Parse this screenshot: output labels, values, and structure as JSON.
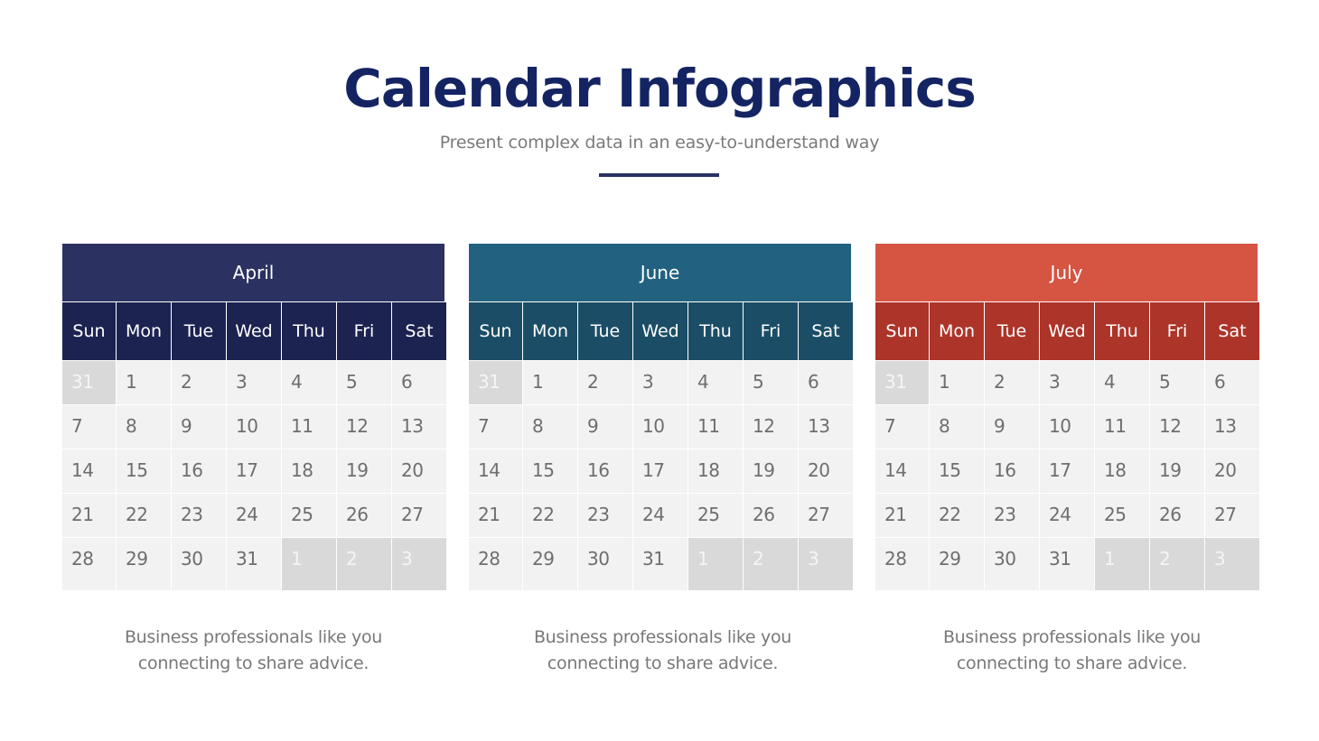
{
  "title": "Calendar Infographics",
  "subtitle": "Present complex data in an easy-to-understand way",
  "weekdays": [
    "Sun",
    "Mon",
    "Tue",
    "Wed",
    "Thu",
    "Fri",
    "Sat"
  ],
  "calendars": [
    {
      "month": "April",
      "header_color": "#2b3262",
      "weekday_color": "#1c2350",
      "caption_line1": "Business professionals like you",
      "caption_line2": "connecting to share advice.",
      "days": [
        {
          "d": "31",
          "other": true
        },
        {
          "d": "1"
        },
        {
          "d": "2"
        },
        {
          "d": "3"
        },
        {
          "d": "4"
        },
        {
          "d": "5"
        },
        {
          "d": "6"
        },
        {
          "d": "7"
        },
        {
          "d": "8"
        },
        {
          "d": "9"
        },
        {
          "d": "10"
        },
        {
          "d": "11"
        },
        {
          "d": "12"
        },
        {
          "d": "13"
        },
        {
          "d": "14"
        },
        {
          "d": "15"
        },
        {
          "d": "16"
        },
        {
          "d": "17"
        },
        {
          "d": "18"
        },
        {
          "d": "19"
        },
        {
          "d": "20"
        },
        {
          "d": "21"
        },
        {
          "d": "22"
        },
        {
          "d": "23"
        },
        {
          "d": "24"
        },
        {
          "d": "25"
        },
        {
          "d": "26"
        },
        {
          "d": "27"
        },
        {
          "d": "28"
        },
        {
          "d": "29"
        },
        {
          "d": "30"
        },
        {
          "d": "31"
        },
        {
          "d": "1",
          "other": true
        },
        {
          "d": "2",
          "other": true
        },
        {
          "d": "3",
          "other": true
        }
      ]
    },
    {
      "month": "June",
      "header_color": "#226280",
      "weekday_color": "#1b4e66",
      "caption_line1": "Business professionals like you",
      "caption_line2": "connecting to share advice.",
      "days": [
        {
          "d": "31",
          "other": true
        },
        {
          "d": "1"
        },
        {
          "d": "2"
        },
        {
          "d": "3"
        },
        {
          "d": "4"
        },
        {
          "d": "5"
        },
        {
          "d": "6"
        },
        {
          "d": "7"
        },
        {
          "d": "8"
        },
        {
          "d": "9"
        },
        {
          "d": "10"
        },
        {
          "d": "11"
        },
        {
          "d": "12"
        },
        {
          "d": "13"
        },
        {
          "d": "14"
        },
        {
          "d": "15"
        },
        {
          "d": "16"
        },
        {
          "d": "17"
        },
        {
          "d": "18"
        },
        {
          "d": "19"
        },
        {
          "d": "20"
        },
        {
          "d": "21"
        },
        {
          "d": "22"
        },
        {
          "d": "23"
        },
        {
          "d": "24"
        },
        {
          "d": "25"
        },
        {
          "d": "26"
        },
        {
          "d": "27"
        },
        {
          "d": "28"
        },
        {
          "d": "29"
        },
        {
          "d": "30"
        },
        {
          "d": "31"
        },
        {
          "d": "1",
          "other": true
        },
        {
          "d": "2",
          "other": true
        },
        {
          "d": "3",
          "other": true
        }
      ]
    },
    {
      "month": "July",
      "header_color": "#d55442",
      "weekday_color": "#ad3429",
      "caption_line1": "Business professionals like you",
      "caption_line2": "connecting to share advice.",
      "days": [
        {
          "d": "31",
          "other": true
        },
        {
          "d": "1"
        },
        {
          "d": "2"
        },
        {
          "d": "3"
        },
        {
          "d": "4"
        },
        {
          "d": "5"
        },
        {
          "d": "6"
        },
        {
          "d": "7"
        },
        {
          "d": "8"
        },
        {
          "d": "9"
        },
        {
          "d": "10"
        },
        {
          "d": "11"
        },
        {
          "d": "12"
        },
        {
          "d": "13"
        },
        {
          "d": "14"
        },
        {
          "d": "15"
        },
        {
          "d": "16"
        },
        {
          "d": "17"
        },
        {
          "d": "18"
        },
        {
          "d": "19"
        },
        {
          "d": "20"
        },
        {
          "d": "21"
        },
        {
          "d": "22"
        },
        {
          "d": "23"
        },
        {
          "d": "24"
        },
        {
          "d": "25"
        },
        {
          "d": "26"
        },
        {
          "d": "27"
        },
        {
          "d": "28"
        },
        {
          "d": "29"
        },
        {
          "d": "30"
        },
        {
          "d": "31"
        },
        {
          "d": "1",
          "other": true
        },
        {
          "d": "2",
          "other": true
        },
        {
          "d": "3",
          "other": true
        }
      ]
    }
  ]
}
